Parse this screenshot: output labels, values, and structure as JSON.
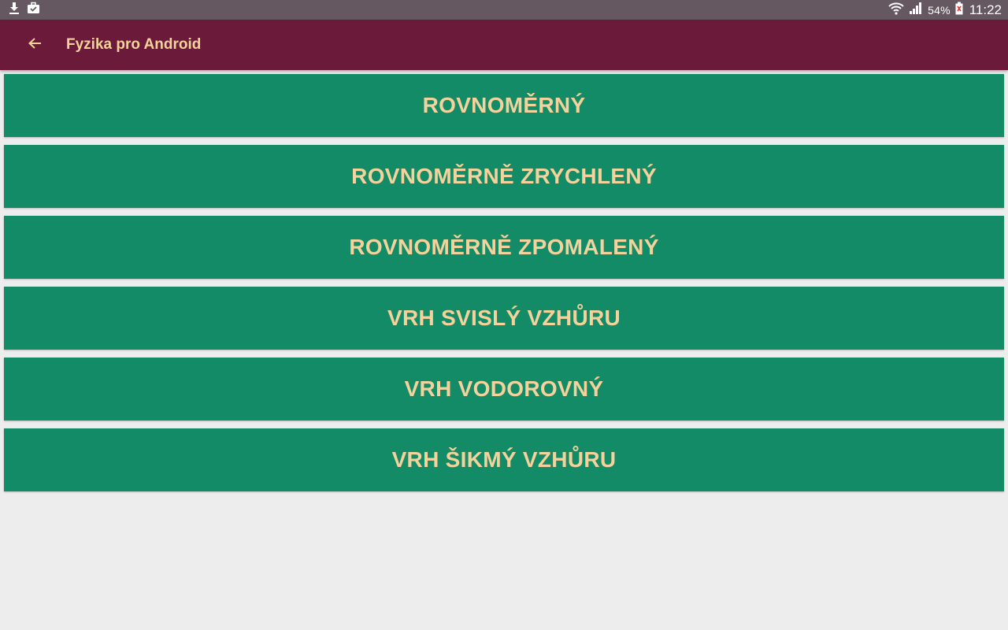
{
  "colors": {
    "status_bar": "#665860",
    "app_bar": "#6b1a39",
    "title_text": "#f4d29c",
    "button_bg": "#148b67",
    "button_text": "#f4d29c",
    "background": "#ededed"
  },
  "status_bar": {
    "left_icons": [
      "download-icon",
      "briefcase-icon"
    ],
    "right_icons": [
      "wifi-icon",
      "signal-icon",
      "battery-icon"
    ],
    "battery": "54%",
    "time": "11:22"
  },
  "app_bar": {
    "back_icon": "arrow-left-icon",
    "title": "Fyzika pro Android"
  },
  "menu": {
    "items": [
      {
        "label": "ROVNOMĚRNÝ"
      },
      {
        "label": "ROVNOMĚRNĚ ZRYCHLENÝ"
      },
      {
        "label": "ROVNOMĚRNĚ ZPOMALENÝ"
      },
      {
        "label": "VRH SVISLÝ VZHŮRU"
      },
      {
        "label": "VRH VODOROVNÝ"
      },
      {
        "label": "VRH ŠIKMÝ VZHŮRU"
      }
    ]
  }
}
